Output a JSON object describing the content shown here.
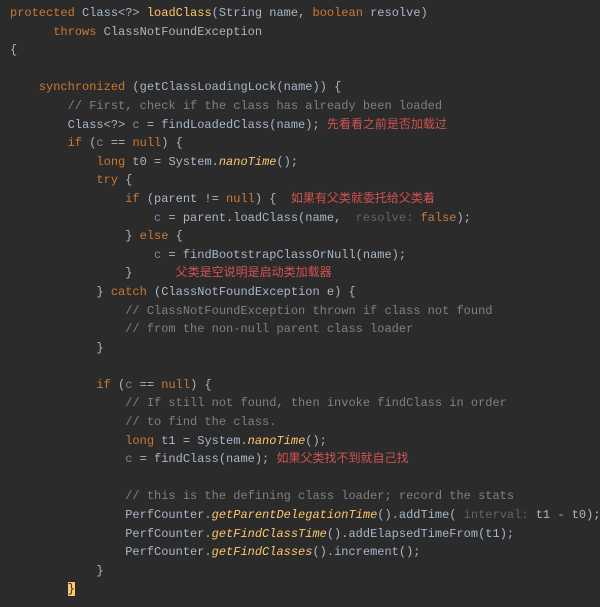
{
  "code": {
    "l1_protected": "protected",
    "l1_class": "Class",
    "l1_g1": "<?> ",
    "l1_fn": "loadClass",
    "l1_open": "(",
    "l1_t1": "String ",
    "l1_p1": "name",
    "l1_c": ", ",
    "l1_t2": "boolean ",
    "l1_p2": "resolve",
    "l1_close": ")",
    "l2_throws": "throws",
    "l2_ex": " ClassNotFoundException",
    "l3_brace": "{",
    "l5_sync": "synchronized",
    "l5_rest": " (getClassLoadingLock(name)) {",
    "l6_cmt": "// First, check if the class has already been loaded",
    "l7_type": "Class<?> ",
    "l7_var": "c",
    "l7_eq": " = findLoadedClass(name);",
    "l7_ann": " 先看看之前是否加载过",
    "l8_if": "if",
    "l8_open": " (",
    "l8_var": "c",
    "l8_rest": " == ",
    "l8_null": "null",
    "l8_close": ") ",
    "l8_brace": "{",
    "l9_long": "long",
    "l9_var": " t0",
    "l9_eq": " = System.",
    "l9_fn": "nanoTime",
    "l9_end": "();",
    "l10_try": "try",
    "l10_brace": " {",
    "l11_if": "if",
    "l11_cond": " (parent != ",
    "l11_null": "null",
    "l11_close": ") {",
    "l11_ann": "  如果有父类就委托给父类着",
    "l12_var": "c",
    "l12_eq": " = parent.loadClass(name, ",
    "l12_hint": " resolve: ",
    "l12_false": "false",
    "l12_end": ");",
    "l13_else": "} ",
    "l13_kw": "else",
    "l13_brace": " {",
    "l14_var": "c",
    "l14_eq": " = findBootstrapClassOrNull(name);",
    "l15_brace": "}",
    "l15_ann": "      父类是空说明是启动类加载器",
    "l16_catch1": "} ",
    "l16_catch": "catch",
    "l16_rest": " (ClassNotFoundException e) {",
    "l17_cmt": "// ClassNotFoundException thrown if class not found",
    "l18_cmt": "// from the non-null parent class loader",
    "l19_brace": "}",
    "l21_if": "if",
    "l21_open": " (",
    "l21_var": "c",
    "l21_eq": " == ",
    "l21_null": "null",
    "l21_close": ") {",
    "l22_cmt": "// If still not found, then invoke findClass in order",
    "l23_cmt": "// to find the class.",
    "l24_long": "long",
    "l24_var": " t1",
    "l24_eq": " = System.",
    "l24_fn": "nanoTime",
    "l24_end": "();",
    "l25_var": "c",
    "l25_eq": " = findClass(name);",
    "l25_ann": " 如果父类找不到就自己找",
    "l27_cmt": "// this is the defining class loader; record the stats",
    "l28_a": "PerfCounter.",
    "l28_fn": "getParentDelegationTime",
    "l28_b": "().addTime(",
    "l28_hint": " interval: ",
    "l28_c": "t1 - t0);",
    "l29_a": "PerfCounter.",
    "l29_fn": "getFindClassTime",
    "l29_b": "().addElapsedTimeFrom(t1);",
    "l30_a": "PerfCounter.",
    "l30_fn": "getFindClasses",
    "l30_b": "().increment();",
    "l31_brace": "}",
    "l32_brace": "}"
  }
}
